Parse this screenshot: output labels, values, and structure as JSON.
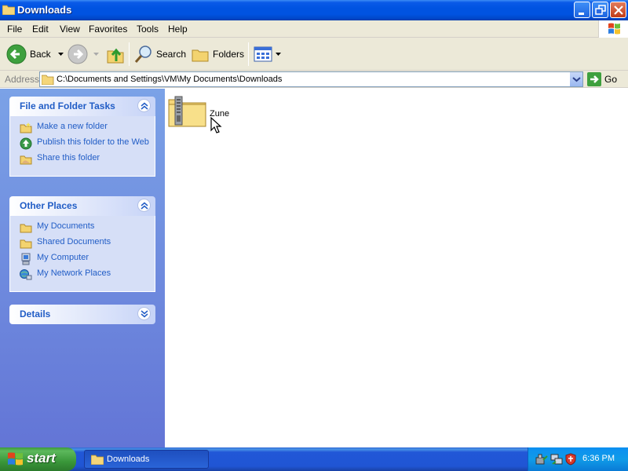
{
  "window": {
    "title": "Downloads",
    "buttons": {
      "minimize": "minimize",
      "maximize": "maximize",
      "close": "close"
    }
  },
  "menu": [
    "File",
    "Edit",
    "View",
    "Favorites",
    "Tools",
    "Help"
  ],
  "toolbar": {
    "back": "Back",
    "search": "Search",
    "folders": "Folders"
  },
  "address": {
    "label": "Address",
    "value": "C:\\Documents and Settings\\VM\\My Documents\\Downloads",
    "go": "Go"
  },
  "sidebar": {
    "tasks": {
      "title": "File and Folder Tasks",
      "items": [
        {
          "label": "Make a new folder",
          "icon": "new-folder-icon"
        },
        {
          "label": "Publish this folder to the Web",
          "icon": "globe-publish-icon"
        },
        {
          "label": "Share this folder",
          "icon": "share-folder-icon"
        }
      ]
    },
    "places": {
      "title": "Other Places",
      "items": [
        {
          "label": "My Documents",
          "icon": "folder-icon"
        },
        {
          "label": "Shared Documents",
          "icon": "folder-icon"
        },
        {
          "label": "My Computer",
          "icon": "computer-icon"
        },
        {
          "label": "My Network Places",
          "icon": "network-icon"
        }
      ]
    },
    "details": {
      "title": "Details"
    }
  },
  "files": [
    {
      "name": "Zune",
      "type": "zipped-folder"
    }
  ],
  "taskbar": {
    "start": "start",
    "tasks": [
      "Downloads"
    ],
    "clock": "6:36 PM"
  },
  "colors": {
    "titlebar": "#0053e1",
    "link": "#215dc6",
    "sidebar_top": "#7ba2e7",
    "sidebar_bottom": "#6375d6",
    "start_green": "#3a973a"
  }
}
